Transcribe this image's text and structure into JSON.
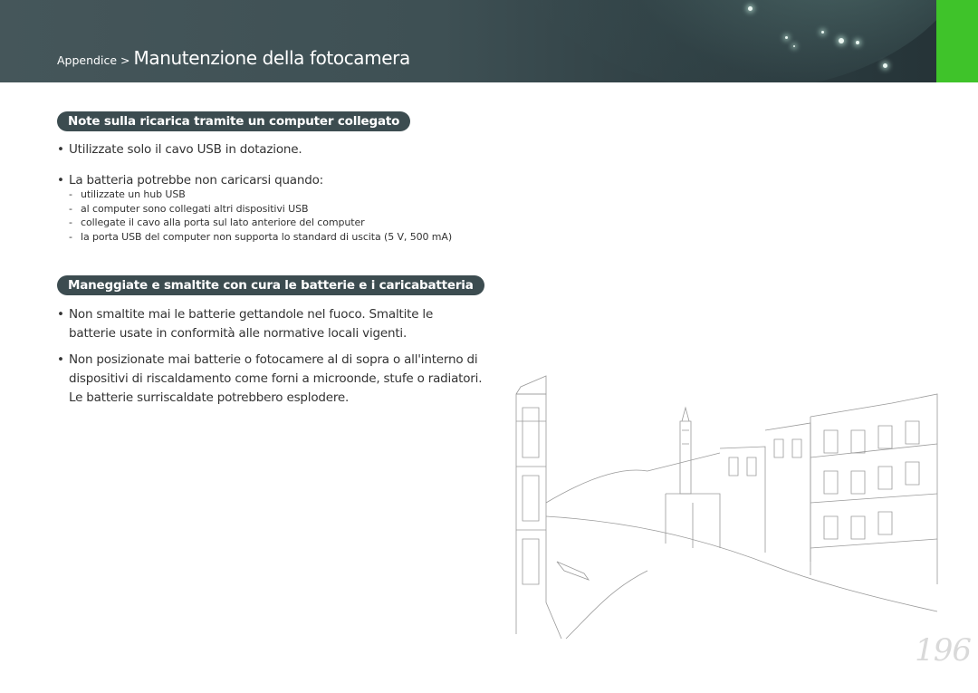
{
  "header": {
    "breadcrumb_parent": "Appendice",
    "breadcrumb_separator": ">",
    "title": "Manutenzione della fotocamera",
    "accent_color": "#3fc32a",
    "background_color": "#3e5054"
  },
  "section1": {
    "heading": "Note sulla ricarica tramite un computer collegato",
    "bullets": [
      "Utilizzate solo il cavo USB in dotazione.",
      "La batteria potrebbe non caricarsi quando:"
    ],
    "sub_items": [
      "utilizzate un hub USB",
      "al computer sono collegati altri dispositivi USB",
      "collegate il cavo alla porta sul lato anteriore del computer",
      "la porta USB del computer non supporta lo standard di uscita (5 V, 500 mA)"
    ]
  },
  "section2": {
    "heading": "Maneggiate e smaltite con cura le batterie e i caricabatteria",
    "bullets": [
      "Non smaltite mai le batterie gettandole nel fuoco. Smaltite le batterie usate in conformità alle normative locali vigenti.",
      "Non posizionate mai batterie o fotocamere al di sopra o all'interno di dispositivi di riscaldamento come forni a microonde, stufe o radiatori. Le batterie surriscaldate potrebbero esplodere."
    ]
  },
  "bullet_symbol": "•",
  "dash_symbol": "-",
  "page_number": "196"
}
